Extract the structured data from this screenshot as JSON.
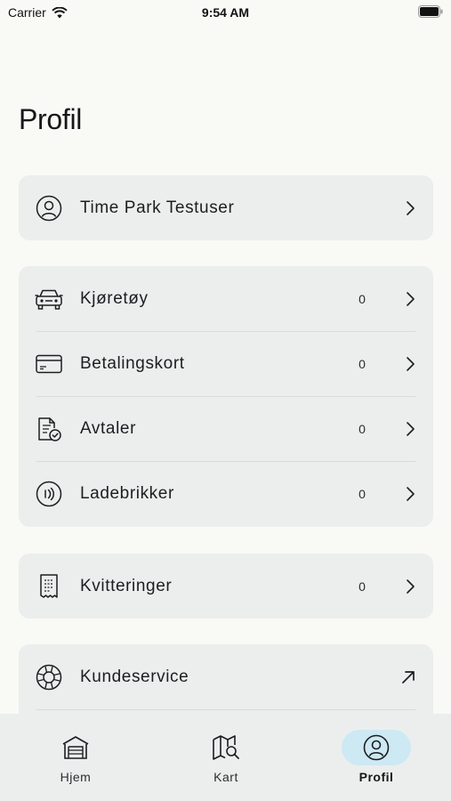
{
  "status_bar": {
    "carrier": "Carrier",
    "time": "9:54 AM"
  },
  "page": {
    "title": "Profil"
  },
  "user_card": {
    "name": "Time Park Testuser",
    "icon": "user-circle-icon"
  },
  "assets_card": {
    "items": [
      {
        "label": "Kjøretøy",
        "count": "0",
        "icon": "car-icon"
      },
      {
        "label": "Betalingskort",
        "count": "0",
        "icon": "credit-card-icon"
      },
      {
        "label": "Avtaler",
        "count": "0",
        "icon": "agreement-document-icon"
      },
      {
        "label": "Ladebrikker",
        "count": "0",
        "icon": "nfc-tag-icon"
      }
    ]
  },
  "receipts_card": {
    "label": "Kvitteringer",
    "count": "0",
    "icon": "receipt-icon"
  },
  "support_card": {
    "label": "Kundeservice",
    "icon": "lifebuoy-icon",
    "action_icon": "external-arrow-icon"
  },
  "tab_bar": {
    "tabs": [
      {
        "label": "Hjem",
        "icon": "garage-icon",
        "active": false
      },
      {
        "label": "Kart",
        "icon": "map-search-icon",
        "active": false
      },
      {
        "label": "Profil",
        "icon": "user-circle-icon",
        "active": true
      }
    ]
  },
  "colors": {
    "background": "#f9f9f6",
    "card": "#eceeee",
    "active_tab_pill": "#cde9f3",
    "text": "#1b1d20"
  }
}
